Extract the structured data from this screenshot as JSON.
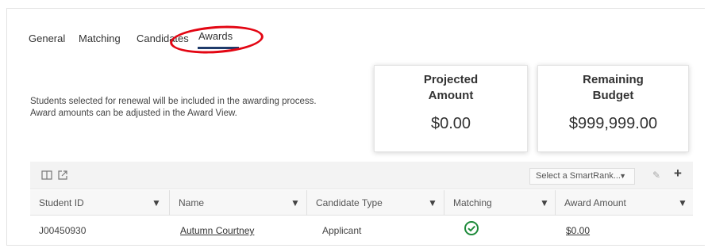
{
  "tabs": [
    {
      "label": "General"
    },
    {
      "label": "Matching"
    },
    {
      "label": "Candidates"
    },
    {
      "label": "Awards",
      "active": true
    }
  ],
  "info": {
    "line1": "Students selected for renewal will be included in the awarding process.",
    "line2": "Award amounts can be adjusted in the Award View."
  },
  "cards": {
    "projected": {
      "title1": "Projected",
      "title2": "Amount",
      "value": "$0.00"
    },
    "remaining": {
      "title1": "Remaining",
      "title2": "Budget",
      "value": "$999,999.00"
    }
  },
  "toolbar": {
    "smartrank_placeholder": "Select a SmartRank...",
    "icons": [
      "columns-icon",
      "external-link-icon",
      "pencil-icon",
      "plus-icon"
    ]
  },
  "table": {
    "columns": [
      "Student ID",
      "Name",
      "Candidate Type",
      "Matching",
      "Award Amount"
    ],
    "rows": [
      {
        "student_id": "J00450930",
        "name": "Autumn Courtney",
        "candidate_type": "Applicant",
        "matching": "check",
        "award_amount": "$0.00"
      }
    ]
  },
  "colors": {
    "tab_underline": "#1f3b6b",
    "annotation": "#e30613",
    "check": "#1e8a3a"
  }
}
